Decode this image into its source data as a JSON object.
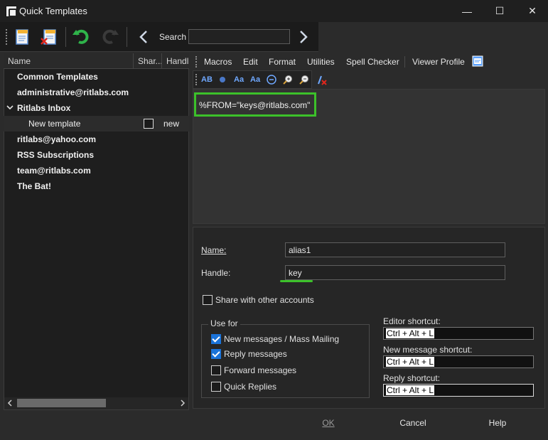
{
  "window": {
    "title": "Quick Templates",
    "controls": {
      "minimize": "—",
      "maximize": "☐",
      "close": "✕"
    }
  },
  "toolbar": {
    "search_label": "Search",
    "search_value": ""
  },
  "tree": {
    "columns": [
      "Name",
      "Shar...",
      "Handl"
    ],
    "items": [
      {
        "label": "Common Templates"
      },
      {
        "label": "administrative@ritlabs.com"
      },
      {
        "label": "Ritlabs Inbox",
        "expanded": true
      },
      {
        "label": "New template",
        "handle": "new"
      },
      {
        "label": "ritlabs@yahoo.com"
      },
      {
        "label": "RSS Subscriptions"
      },
      {
        "label": "team@ritlabs.com"
      },
      {
        "label": "The Bat!"
      }
    ]
  },
  "menu": {
    "items": [
      "Macros",
      "Edit",
      "Format",
      "Utilities",
      "Spell Checker",
      "Viewer Profile"
    ]
  },
  "format_bar": {
    "icons": [
      "AB",
      "Aa",
      "Aa"
    ]
  },
  "editor": {
    "text": "%FROM=\"keys@ritlabs.com\""
  },
  "props": {
    "name_label": "Name:",
    "name_value": "alias1",
    "handle_label": "Handle:",
    "handle_value": "key",
    "share_label": "Share with other accounts",
    "use_for_label": "Use for",
    "use_for": [
      {
        "label": "New messages / Mass Mailing",
        "checked": true
      },
      {
        "label": "Reply messages",
        "checked": true
      },
      {
        "label": "Forward messages",
        "checked": false
      },
      {
        "label": "Quick Replies",
        "checked": false
      }
    ],
    "editor_shortcut_label": "Editor shortcut:",
    "editor_shortcut": "Ctrl + Alt + L",
    "new_message_shortcut_label": "New message shortcut:",
    "new_message_shortcut": "Ctrl + Alt + L",
    "reply_shortcut_label": "Reply shortcut:",
    "reply_shortcut": "Ctrl + Alt + L"
  },
  "buttons": {
    "ok": "OK",
    "cancel": "Cancel",
    "help": "Help"
  },
  "colors": {
    "accent_green": "#3cc12a",
    "check_blue": "#1a73d9"
  }
}
